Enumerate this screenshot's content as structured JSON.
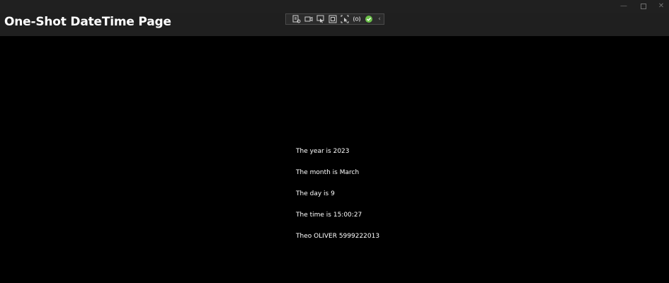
{
  "window": {
    "minimize_glyph": "—",
    "close_glyph": "✕"
  },
  "header": {
    "title": "One-Shot DateTime Page"
  },
  "debug_toolbar": {
    "icons": [
      "live-visual-tree-icon",
      "video-capture-icon",
      "select-element-icon",
      "display-layout-adorners-icon",
      "track-focus-icon",
      "binding-failures-icon",
      "hot-reload-status-icon"
    ],
    "collapse_glyph": "‹",
    "hot_reload_color": "#6cc24a"
  },
  "content": {
    "year_line": "The year is 2023",
    "month_line": "The month is March",
    "day_line": "The day is 9",
    "time_line": "The time is 15:00:27",
    "author_line": "Theo OLIVER 5999222013"
  }
}
